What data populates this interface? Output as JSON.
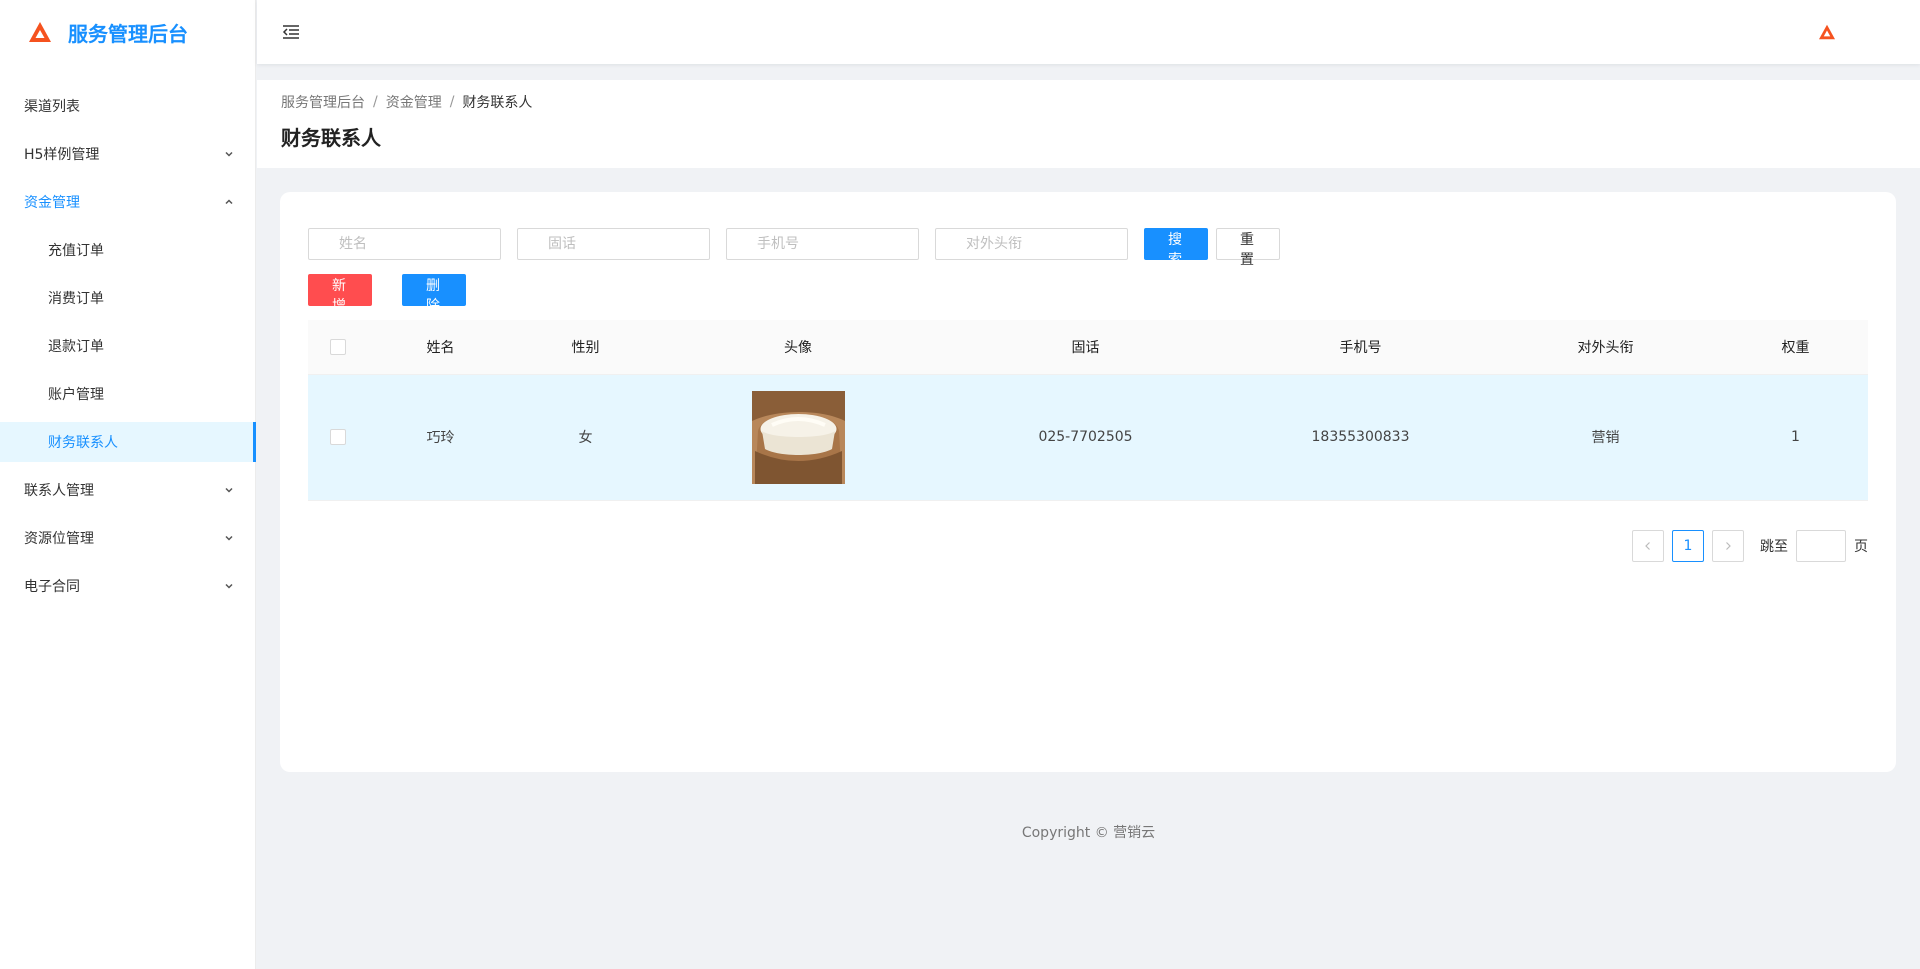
{
  "app": {
    "title": "服务管理后台"
  },
  "sidebar": {
    "items": [
      {
        "label": "渠道列表"
      },
      {
        "label": "H5样例管理"
      },
      {
        "label": "资金管理"
      },
      {
        "label": "充值订单"
      },
      {
        "label": "消费订单"
      },
      {
        "label": "退款订单"
      },
      {
        "label": "账户管理"
      },
      {
        "label": "财务联系人"
      },
      {
        "label": "联系人管理"
      },
      {
        "label": "资源位管理"
      },
      {
        "label": "电子合同"
      }
    ]
  },
  "breadcrumb": [
    "服务管理后台",
    "资金管理",
    "财务联系人"
  ],
  "breadcrumb_sep": "/",
  "page": {
    "title": "财务联系人"
  },
  "search": {
    "name_placeholder": "姓名",
    "phone_placeholder": "固话",
    "mobile_placeholder": "手机号",
    "title_placeholder": "对外头衔",
    "search_label": "搜 索",
    "reset_label": "重 置"
  },
  "actions": {
    "add_label": "新 增",
    "delete_label": "删 除"
  },
  "table": {
    "columns": [
      "姓名",
      "性别",
      "头像",
      "固话",
      "手机号",
      "对外头衔",
      "权重"
    ],
    "rows": [
      {
        "name": "巧玲",
        "gender": "女",
        "avatar": "rice-sack-image",
        "phone": "025-7702505",
        "mobile": "18355300833",
        "title": "营销",
        "weight": "1"
      }
    ]
  },
  "pagination": {
    "current": "1",
    "jump_prefix": "跳至",
    "jump_suffix": "页"
  },
  "footer": {
    "copyright": "Copyright © 营销云"
  },
  "colors": {
    "primary": "#1890ff",
    "danger": "#ff4d4f",
    "logo": "#f5521f"
  }
}
